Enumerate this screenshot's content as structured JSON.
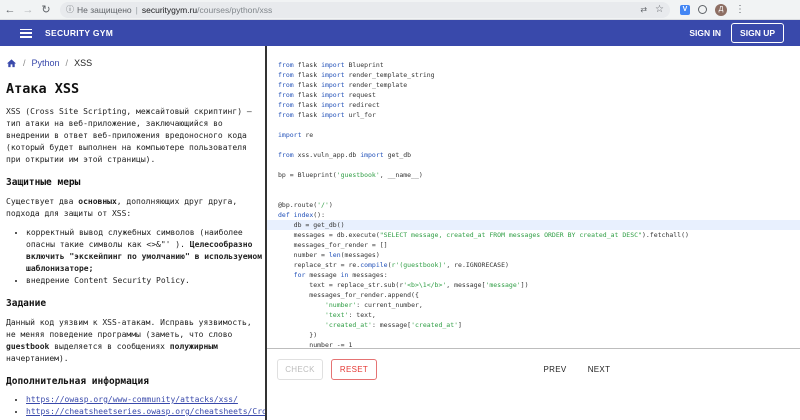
{
  "browser": {
    "security_label": "Не защищено",
    "url_host": "securitygym.ru",
    "url_path": "/courses/python/xss",
    "avatar_letter": "Д",
    "ext_badge": "V"
  },
  "appbar": {
    "brand": "SECURITY GYM",
    "signin": "SIGN IN",
    "signup": "SIGN UP",
    "color": "#3949ab"
  },
  "breadcrumb": {
    "section": "Python",
    "current": "XSS"
  },
  "lesson": {
    "title": "Атака XSS",
    "intro": "XSS (Cross Site Scripting, межсайтовый скриптинг) – тип атаки на веб-приложение, заключающийся во внедрении в ответ веб-приложения вредоносного кода (который будет выполнен на компьютере пользователя при открытии им этой страницы).",
    "defense_heading": "Защитные меры",
    "defense_intro_1": "Существует два ",
    "defense_intro_bold": "основных",
    "defense_intro_2": ", дополняющих друг друга, подхода для защиты от XSS:",
    "defense_item1_a": "корректный вывод служебных символов (наиболее опасны такие символы как <>&\"' ). ",
    "defense_item1_b": "Целесообразно включить \"экскейпинг по умолчанию\" в используемом шаблонизаторе;",
    "defense_item2": "внедрение Content Security Policy.",
    "task_heading": "Задание",
    "task_1": "Данный код уязвим к XSS-атакам. Исправь уязвимость, не меняя поведение программы (заметь, что слово ",
    "task_bold1": "guestbook",
    "task_2": " выделяется в сообщениях ",
    "task_bold2": "полужирным",
    "task_3": " начертанием).",
    "more_heading": "Дополнительная информация",
    "links": [
      "https://owasp.org/www-community/attacks/xss/",
      "https://cheatsheetseries.owasp.org/cheatsheets/Cros"
    ]
  },
  "code_lines": [
    [
      [
        "kw",
        "from"
      ],
      [
        "t",
        " flask "
      ],
      [
        "kw",
        "import"
      ],
      [
        "t",
        " Blueprint"
      ]
    ],
    [
      [
        "kw",
        "from"
      ],
      [
        "t",
        " flask "
      ],
      [
        "kw",
        "import"
      ],
      [
        "t",
        " render_template_string"
      ]
    ],
    [
      [
        "kw",
        "from"
      ],
      [
        "t",
        " flask "
      ],
      [
        "kw",
        "import"
      ],
      [
        "t",
        " render_template"
      ]
    ],
    [
      [
        "kw",
        "from"
      ],
      [
        "t",
        " flask "
      ],
      [
        "kw",
        "import"
      ],
      [
        "t",
        " request"
      ]
    ],
    [
      [
        "kw",
        "from"
      ],
      [
        "t",
        " flask "
      ],
      [
        "kw",
        "import"
      ],
      [
        "t",
        " redirect"
      ]
    ],
    [
      [
        "kw",
        "from"
      ],
      [
        "t",
        " flask "
      ],
      [
        "kw",
        "import"
      ],
      [
        "t",
        " url_for"
      ]
    ],
    [],
    [
      [
        "kw",
        "import"
      ],
      [
        "t",
        " re"
      ]
    ],
    [],
    [
      [
        "kw",
        "from"
      ],
      [
        "t",
        " xss.vuln_app.db "
      ],
      [
        "kw",
        "import"
      ],
      [
        "t",
        " get_db"
      ]
    ],
    [],
    [
      [
        "t",
        "bp = Blueprint("
      ],
      [
        "str",
        "'guestbook'"
      ],
      [
        "t",
        ", __name__)"
      ]
    ],
    [],
    [],
    [
      [
        "t",
        "@bp.route("
      ],
      [
        "str",
        "'/'"
      ],
      [
        "t",
        ")"
      ]
    ],
    [
      [
        "kw",
        "def"
      ],
      [
        "t",
        " "
      ],
      [
        "fn",
        "index"
      ],
      [
        "t",
        "():"
      ]
    ],
    [
      [
        "t",
        "    db = get_db()"
      ]
    ],
    [
      [
        "t",
        "    messages = db.execute("
      ],
      [
        "str",
        "\"SELECT message, created_at FROM messages ORDER BY created_at DESC\""
      ],
      [
        "t",
        ").fetchall()"
      ]
    ],
    [
      [
        "t",
        "    messages_for_render = []"
      ]
    ],
    [
      [
        "t",
        "    number = "
      ],
      [
        "fn",
        "len"
      ],
      [
        "t",
        "(messages)"
      ]
    ],
    [
      [
        "t",
        "    replace_str = re."
      ],
      [
        "fn",
        "compile"
      ],
      [
        "t",
        "("
      ],
      [
        "str",
        "r'(guestbook)'"
      ],
      [
        "t",
        ", re.IGNORECASE)"
      ]
    ],
    [
      [
        "t",
        "    "
      ],
      [
        "kw",
        "for"
      ],
      [
        "t",
        " message "
      ],
      [
        "kw",
        "in"
      ],
      [
        "t",
        " messages:"
      ]
    ],
    [
      [
        "t",
        "        text = replace_str.sub(r"
      ],
      [
        "str",
        "'<b>\\1</b>'"
      ],
      [
        "t",
        ", message["
      ],
      [
        "str",
        "'message'"
      ],
      [
        "t",
        "])"
      ]
    ],
    [
      [
        "t",
        "        messages_for_render.append({"
      ]
    ],
    [
      [
        "t",
        "            "
      ],
      [
        "str",
        "'number'"
      ],
      [
        "t",
        ": current_number,"
      ]
    ],
    [
      [
        "t",
        "            "
      ],
      [
        "str",
        "'text'"
      ],
      [
        "t",
        ": text,"
      ]
    ],
    [
      [
        "t",
        "            "
      ],
      [
        "str",
        "'created_at'"
      ],
      [
        "t",
        ": message["
      ],
      [
        "str",
        "'created_at'"
      ],
      [
        "t",
        "]"
      ]
    ],
    [
      [
        "t",
        "        })"
      ]
    ],
    [
      [
        "t",
        "        number -= 1"
      ]
    ]
  ],
  "controls": {
    "check": "CHECK",
    "reset": "RESET",
    "prev": "PREV",
    "next": "NEXT"
  }
}
